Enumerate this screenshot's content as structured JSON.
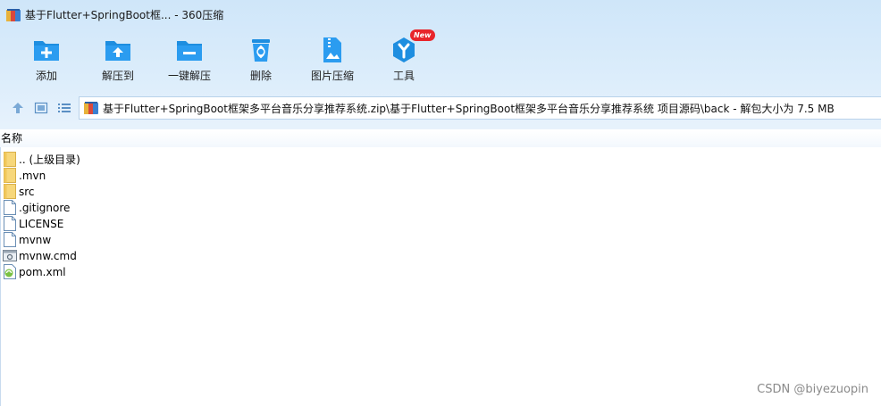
{
  "window": {
    "title": "基于Flutter+SpringBoot框... - 360压缩"
  },
  "toolbar": {
    "items": [
      {
        "label": "添加",
        "icon": "add-folder-icon"
      },
      {
        "label": "解压到",
        "icon": "extract-to-icon"
      },
      {
        "label": "一键解压",
        "icon": "one-click-extract-icon"
      },
      {
        "label": "删除",
        "icon": "recycle-bin-icon"
      },
      {
        "label": "图片压缩",
        "icon": "image-compress-icon"
      },
      {
        "label": "工具",
        "icon": "tools-icon",
        "badge": "New"
      }
    ]
  },
  "navigation": {
    "up_icon": "up-arrow-icon",
    "thumbnail_view_icon": "thumbnail-view-icon",
    "list_view_icon": "list-view-icon"
  },
  "address": {
    "path": "基于Flutter+SpringBoot框架多平台音乐分享推荐系统.zip\\基于Flutter+SpringBoot框架多平台音乐分享推荐系统 项目源码\\back - 解包大小为 7.5 MB"
  },
  "list": {
    "column_name": "名称",
    "items": [
      {
        "name": ".. (上级目录)",
        "type": "folder"
      },
      {
        "name": ".mvn",
        "type": "folder"
      },
      {
        "name": "src",
        "type": "folder"
      },
      {
        "name": ".gitignore",
        "type": "file"
      },
      {
        "name": "LICENSE",
        "type": "file"
      },
      {
        "name": "mvnw",
        "type": "file"
      },
      {
        "name": "mvnw.cmd",
        "type": "cmd"
      },
      {
        "name": "pom.xml",
        "type": "xml"
      }
    ]
  },
  "watermark": "CSDN @biyezuopin",
  "colors": {
    "accent_blue": "#1e8ee0",
    "badge_red": "#e8252b",
    "folder_yellow": "#f7d77a"
  }
}
